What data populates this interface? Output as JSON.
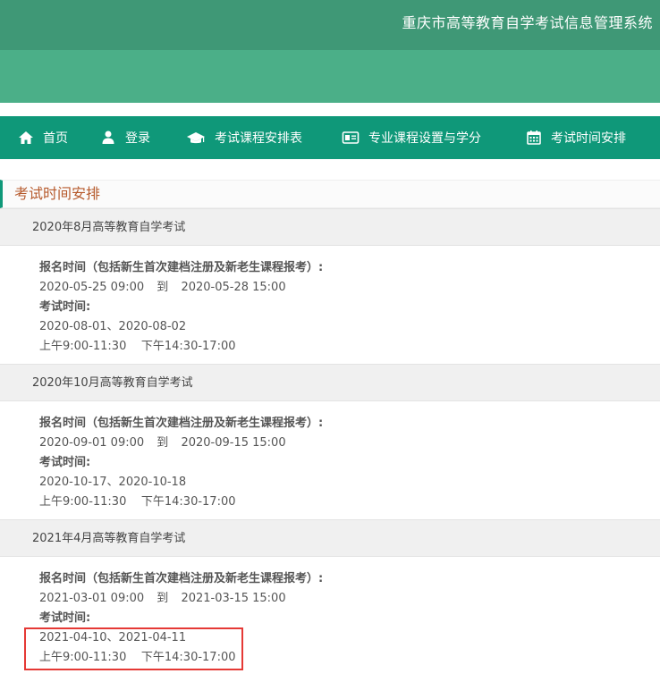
{
  "header": {
    "title": "重庆市高等教育自学考试信息管理系统"
  },
  "nav": [
    {
      "label": "首页",
      "icon": "home-icon"
    },
    {
      "label": "登录",
      "icon": "user-icon"
    },
    {
      "label": "考试课程安排表",
      "icon": "graduation-cap-icon"
    },
    {
      "label": "专业课程设置与学分",
      "icon": "id-card-icon"
    },
    {
      "label": "考试时间安排",
      "icon": "calendar-icon"
    }
  ],
  "section": {
    "title": "考试时间安排"
  },
  "exams": [
    {
      "name": "2020年8月高等教育自学考试",
      "reg_label": "报名时间（包括新生首次建档注册及新老生课程报考）:",
      "reg_start": "2020-05-25 09:00",
      "to": "到",
      "reg_end": "2020-05-28 15:00",
      "exam_label": "考试时间:",
      "exam_dates": "2020-08-01、2020-08-02",
      "exam_hours": "上午9:00-11:30    下午14:30-17:00"
    },
    {
      "name": "2020年10月高等教育自学考试",
      "reg_label": "报名时间（包括新生首次建档注册及新老生课程报考）:",
      "reg_start": "2020-09-01 09:00",
      "to": "到",
      "reg_end": "2020-09-15 15:00",
      "exam_label": "考试时间:",
      "exam_dates": "2020-10-17、2020-10-18",
      "exam_hours": "上午9:00-11:30    下午14:30-17:00"
    },
    {
      "name": "2021年4月高等教育自学考试",
      "reg_label": "报名时间（包括新生首次建档注册及新老生课程报考）:",
      "reg_start": "2021-03-01 09:00",
      "to": "到",
      "reg_end": "2021-03-15 15:00",
      "exam_label": "考试时间:",
      "exam_dates": "2021-04-10、2021-04-11",
      "exam_hours": "上午9:00-11:30    下午14:30-17:00"
    }
  ],
  "colors": {
    "header_dark": "#3f9876",
    "header_light": "#4baf88",
    "nav": "#0f9879",
    "section_title": "#b65a2c",
    "highlight": "#e53935"
  }
}
